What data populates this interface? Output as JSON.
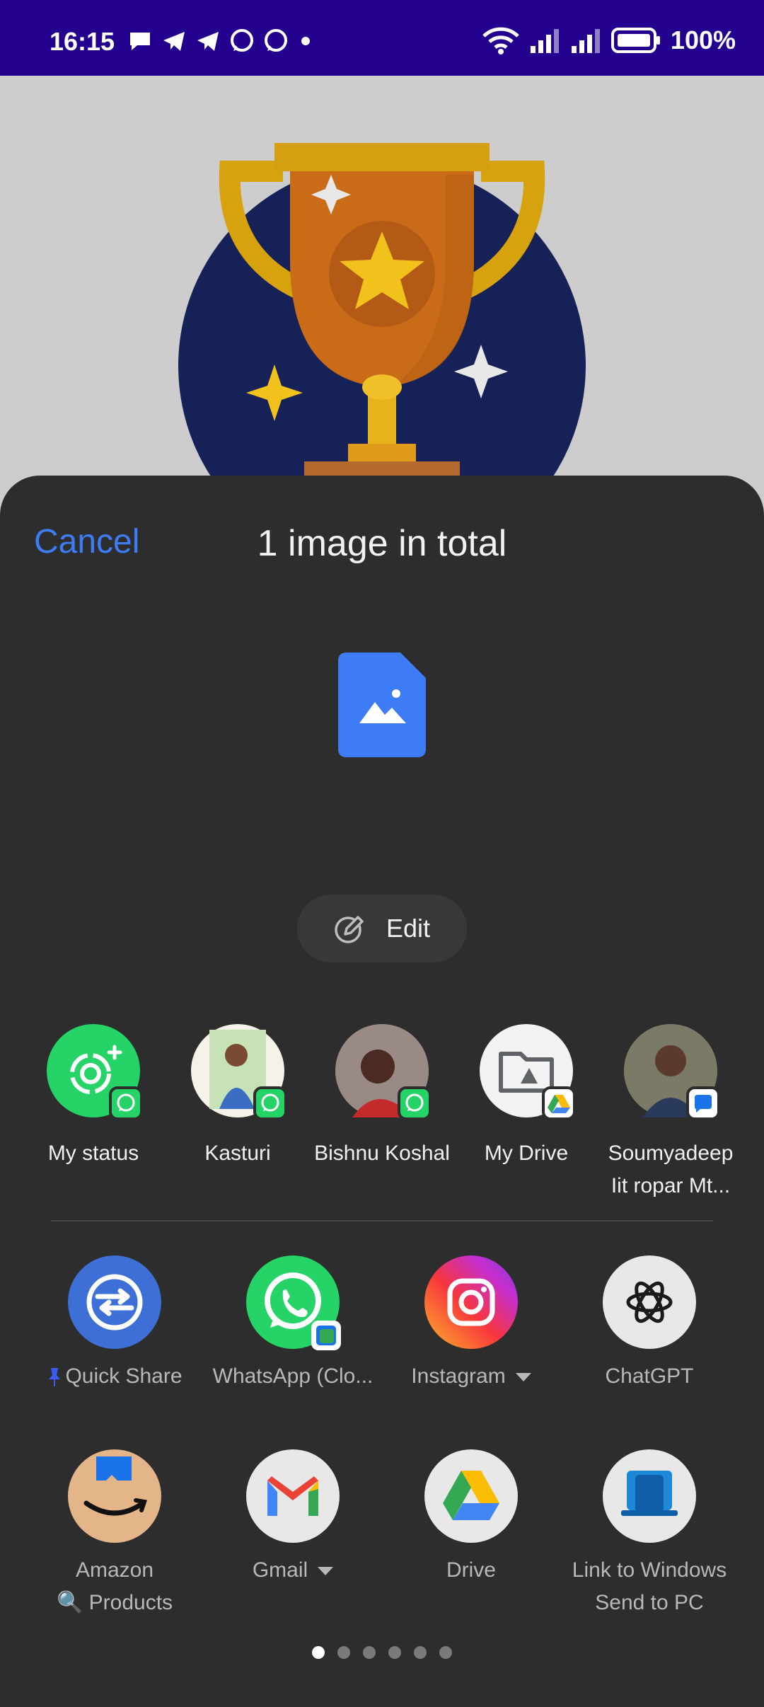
{
  "status_bar": {
    "time": "16:15",
    "battery": "100%"
  },
  "share_sheet": {
    "cancel_label": "Cancel",
    "title": "1 image in total",
    "edit_label": "Edit",
    "accent_color": "#3d7cf5"
  },
  "direct_share": [
    {
      "label": "My status",
      "badge": "whatsapp-icon"
    },
    {
      "label": "Kasturi",
      "badge": "whatsapp-icon"
    },
    {
      "label": "Bishnu Koshal",
      "badge": "whatsapp-icon"
    },
    {
      "label": "My Drive",
      "badge": "google-drive-icon"
    },
    {
      "label": "Soumyadeep Iit ropar Mt...",
      "badge": "messages-icon"
    }
  ],
  "apps_row1": [
    {
      "label": "Quick Share",
      "pinned": true
    },
    {
      "label": "WhatsApp (Clo...",
      "pinned": false
    },
    {
      "label": "Instagram",
      "pinned": false,
      "dropdown": true
    },
    {
      "label": "ChatGPT",
      "pinned": false
    }
  ],
  "apps_row2": [
    {
      "label": "Amazon",
      "sublabel": "🔍 Products"
    },
    {
      "label": "Gmail",
      "dropdown": true
    },
    {
      "label": "Drive"
    },
    {
      "label": "Link to Windows",
      "sublabel": "Send to PC"
    }
  ],
  "pagination": {
    "pages": 6,
    "current": 1
  }
}
